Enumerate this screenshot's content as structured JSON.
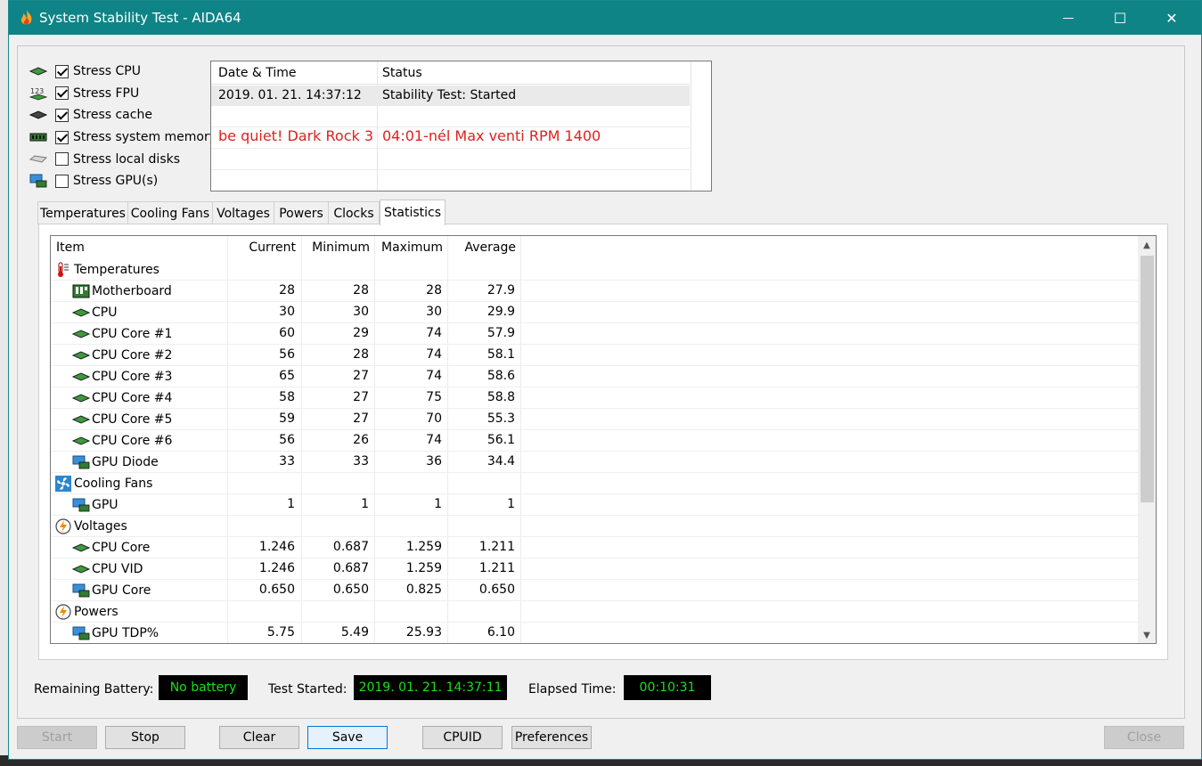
{
  "window": {
    "title": "System Stability Test - AIDA64",
    "minimize_glyph": "—",
    "maximize_glyph": "☐",
    "close_glyph": "✕"
  },
  "stress": [
    {
      "label": "Stress CPU",
      "checked": true,
      "icon": "cpu-chip-icon"
    },
    {
      "label": "Stress FPU",
      "checked": true,
      "icon": "fpu-123-icon"
    },
    {
      "label": "Stress cache",
      "checked": true,
      "icon": "cache-chip-icon"
    },
    {
      "label": "Stress system memory",
      "checked": true,
      "icon": "memory-module-icon"
    },
    {
      "label": "Stress local disks",
      "checked": false,
      "icon": "disk-drive-icon"
    },
    {
      "label": "Stress GPU(s)",
      "checked": false,
      "icon": "gpu-monitor-icon"
    }
  ],
  "log": {
    "col_datetime": "Date & Time",
    "col_status": "Status",
    "row1_datetime": "2019. 01. 21. 14:37:12",
    "row1_status": "Stability Test: Started",
    "note_left": "be quiet! Dark Rock 3",
    "note_right": "04:01-nél Max venti RPM 1400"
  },
  "tabs": [
    "Temperatures",
    "Cooling Fans",
    "Voltages",
    "Powers",
    "Clocks",
    "Statistics"
  ],
  "active_tab": "Statistics",
  "stats": {
    "headers": [
      "Item",
      "Current",
      "Minimum",
      "Maximum",
      "Average"
    ],
    "rows": [
      {
        "kind": "group",
        "name": "Temperatures",
        "icon": "thermometer-icon"
      },
      {
        "kind": "item",
        "name": "Motherboard",
        "icon": "motherboard-icon",
        "current": "28",
        "min": "28",
        "max": "28",
        "avg": "27.9"
      },
      {
        "kind": "item",
        "name": "CPU",
        "icon": "cpu-chip-icon",
        "current": "30",
        "min": "30",
        "max": "30",
        "avg": "29.9"
      },
      {
        "kind": "item",
        "name": "CPU Core #1",
        "icon": "cpu-chip-icon",
        "current": "60",
        "min": "29",
        "max": "74",
        "avg": "57.9"
      },
      {
        "kind": "item",
        "name": "CPU Core #2",
        "icon": "cpu-chip-icon",
        "current": "56",
        "min": "28",
        "max": "74",
        "avg": "58.1"
      },
      {
        "kind": "item",
        "name": "CPU Core #3",
        "icon": "cpu-chip-icon",
        "current": "65",
        "min": "27",
        "max": "74",
        "avg": "58.6"
      },
      {
        "kind": "item",
        "name": "CPU Core #4",
        "icon": "cpu-chip-icon",
        "current": "58",
        "min": "27",
        "max": "75",
        "avg": "58.8"
      },
      {
        "kind": "item",
        "name": "CPU Core #5",
        "icon": "cpu-chip-icon",
        "current": "59",
        "min": "27",
        "max": "70",
        "avg": "55.3"
      },
      {
        "kind": "item",
        "name": "CPU Core #6",
        "icon": "cpu-chip-icon",
        "current": "56",
        "min": "26",
        "max": "74",
        "avg": "56.1"
      },
      {
        "kind": "item",
        "name": "GPU Diode",
        "icon": "gpu-monitor-icon",
        "current": "33",
        "min": "33",
        "max": "36",
        "avg": "34.4"
      },
      {
        "kind": "group",
        "name": "Cooling Fans",
        "icon": "fan-icon"
      },
      {
        "kind": "item",
        "name": "GPU",
        "icon": "gpu-monitor-icon",
        "current": "1",
        "min": "1",
        "max": "1",
        "avg": "1"
      },
      {
        "kind": "group",
        "name": "Voltages",
        "icon": "voltage-icon"
      },
      {
        "kind": "item",
        "name": "CPU Core",
        "icon": "cpu-chip-icon",
        "current": "1.246",
        "min": "0.687",
        "max": "1.259",
        "avg": "1.211"
      },
      {
        "kind": "item",
        "name": "CPU VID",
        "icon": "cpu-chip-icon",
        "current": "1.246",
        "min": "0.687",
        "max": "1.259",
        "avg": "1.211"
      },
      {
        "kind": "item",
        "name": "GPU Core",
        "icon": "gpu-monitor-icon",
        "current": "0.650",
        "min": "0.650",
        "max": "0.825",
        "avg": "0.650"
      },
      {
        "kind": "group",
        "name": "Powers",
        "icon": "power-icon"
      },
      {
        "kind": "item",
        "name": "GPU TDP%",
        "icon": "gpu-monitor-icon",
        "current": "5.75",
        "min": "5.49",
        "max": "25.93",
        "avg": "6.10"
      }
    ]
  },
  "status": {
    "battery_label": "Remaining Battery:",
    "battery_value": "No battery",
    "started_label": "Test Started:",
    "started_value": "2019. 01. 21. 14:37:11",
    "elapsed_label": "Elapsed Time:",
    "elapsed_value": "00:10:31"
  },
  "buttons": {
    "start": "Start",
    "stop": "Stop",
    "clear": "Clear",
    "save": "Save",
    "cpuid": "CPUID",
    "preferences": "Preferences",
    "close": "Close"
  },
  "colors": {
    "titlebar": "#0e8486",
    "lcd_text": "#19e019",
    "note_red": "#e02020"
  }
}
